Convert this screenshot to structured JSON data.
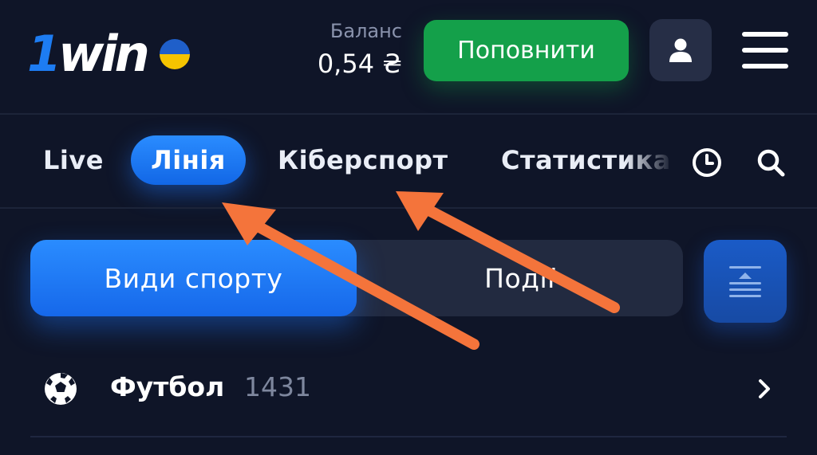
{
  "header": {
    "logo": {
      "brand_one": "1",
      "brand_rest": "win",
      "flag_colors": [
        "#1f5fc9",
        "#f5c400"
      ]
    },
    "balance_label": "Баланс",
    "balance_value": "0,54 ₴",
    "deposit_label": "Поповнити",
    "profile_icon": "user-icon",
    "menu_icon": "hamburger-menu-icon"
  },
  "tabs": {
    "items": [
      {
        "label": "Live",
        "active": false
      },
      {
        "label": "Лінія",
        "active": true
      },
      {
        "label": "Кіберспорт",
        "active": false
      },
      {
        "label": "Статистика",
        "active": false
      }
    ],
    "icons": [
      "clock-icon",
      "search-icon"
    ]
  },
  "segmented": {
    "options": [
      {
        "label": "Види спорту",
        "active": true
      },
      {
        "label": "Події",
        "active": false
      }
    ],
    "collapse_icon": "collapse-icon"
  },
  "sports": [
    {
      "name": "Футбол",
      "count": "1431",
      "icon": "soccer-ball-icon"
    }
  ],
  "colors": {
    "background": "#0f1528",
    "accent_blue": "#1d7cf2",
    "deposit_green": "#14a04a",
    "profile_bg": "#262e46",
    "segment_bg": "#222a40",
    "annotation_orange": "#f4743b",
    "muted_text": "#8a93ad"
  }
}
